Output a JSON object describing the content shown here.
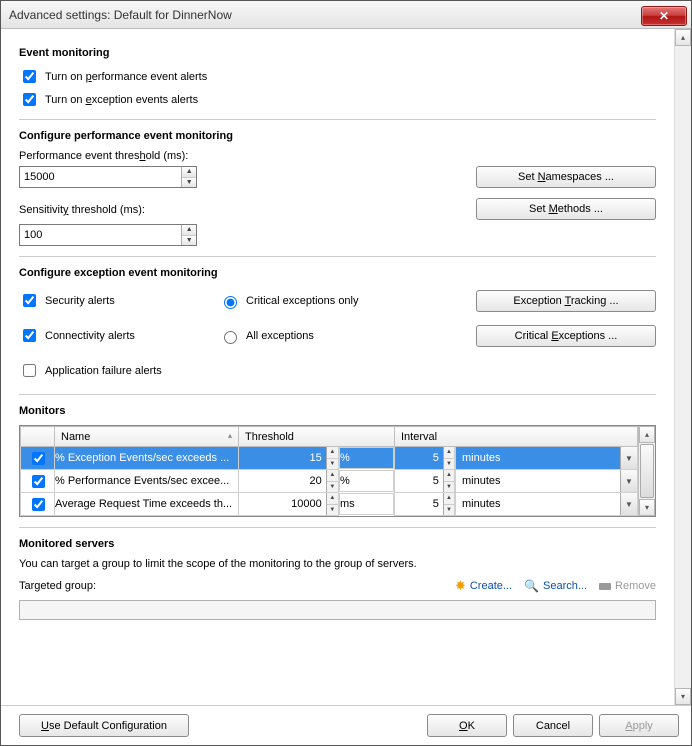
{
  "window": {
    "title": "Advanced settings: Default for DinnerNow"
  },
  "event_monitoring": {
    "heading": "Event monitoring",
    "perf_alerts_label": "Turn on performance event alerts",
    "perf_alerts_checked": true,
    "exc_alerts_label": "Turn on exception events alerts",
    "exc_alerts_checked": true
  },
  "perf_config": {
    "heading": "Configure performance event monitoring",
    "threshold_label": "Performance event threshold (ms):",
    "threshold_value": "15000",
    "sensitivity_label": "Sensitivity threshold (ms):",
    "sensitivity_value": "100",
    "btn_namespaces": "Set Namespaces ...",
    "btn_methods": "Set Methods ..."
  },
  "exc_config": {
    "heading": "Configure exception event monitoring",
    "security_label": "Security alerts",
    "security_checked": true,
    "connectivity_label": "Connectivity alerts",
    "connectivity_checked": true,
    "appfail_label": "Application failure alerts",
    "appfail_checked": false,
    "radio_critical_label": "Critical exceptions only",
    "radio_all_label": "All exceptions",
    "radio_selected": "critical",
    "btn_tracking": "Exception Tracking ...",
    "btn_critical": "Critical Exceptions ..."
  },
  "monitors": {
    "heading": "Monitors",
    "columns": {
      "check": "",
      "name": "Name",
      "threshold": "Threshold",
      "interval": "Interval"
    },
    "rows": [
      {
        "checked": true,
        "selected": true,
        "name": "% Exception Events/sec exceeds ...",
        "threshold": "15",
        "unit": "%",
        "interval": "5",
        "interval_unit": "minutes"
      },
      {
        "checked": true,
        "selected": false,
        "name": "% Performance Events/sec excee...",
        "threshold": "20",
        "unit": "%",
        "interval": "5",
        "interval_unit": "minutes"
      },
      {
        "checked": true,
        "selected": false,
        "name": "Average Request Time exceeds th...",
        "threshold": "10000",
        "unit": "ms",
        "interval": "5",
        "interval_unit": "minutes"
      }
    ]
  },
  "servers": {
    "heading": "Monitored servers",
    "description": "You can target a group to limit the scope of the monitoring to the group of servers.",
    "targeted_label": "Targeted group:",
    "create": "Create...",
    "search": "Search...",
    "remove": "Remove"
  },
  "footer": {
    "use_default": "Use Default Configuration",
    "ok": "OK",
    "cancel": "Cancel",
    "apply": "Apply"
  }
}
